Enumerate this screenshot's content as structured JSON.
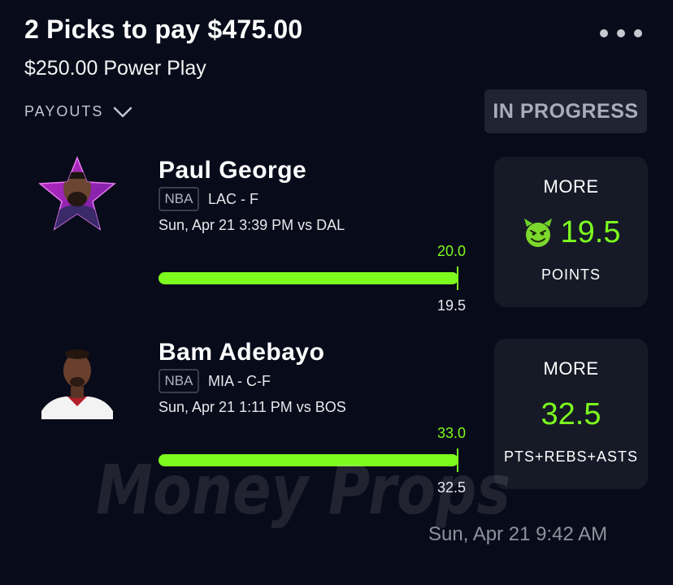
{
  "header": {
    "title": "2 Picks to pay $475.00",
    "subtitle": "$250.00 Power Play",
    "payouts_label": "PAYOUTS",
    "status": "IN PROGRESS"
  },
  "picks": [
    {
      "name": "Paul George",
      "league": "NBA",
      "team_pos": "LAC - F",
      "game_time": "Sun, Apr 21 3:39 PM  vs DAL",
      "actual": "20.0",
      "line": "19.5",
      "progress_fraction": 1.0,
      "direction": "MORE",
      "line_display": "19.5",
      "stat": "POINTS",
      "demon": true
    },
    {
      "name": "Bam Adebayo",
      "league": "NBA",
      "team_pos": "MIA - C-F",
      "game_time": "Sun, Apr 21 1:11 PM  vs BOS",
      "actual": "33.0",
      "line": "32.5",
      "progress_fraction": 1.0,
      "direction": "MORE",
      "line_display": "32.5",
      "stat": "PTS+REBS+ASTS",
      "demon": false
    }
  ],
  "watermark": "Money Props",
  "timestamp": "Sun, Apr 21 9:42 AM",
  "colors": {
    "background": "#080b1a",
    "accent_green": "#7dfa1e",
    "card": "#161a27",
    "badge": "#1f2432"
  },
  "icons": [
    "more-icon",
    "chevron-down-icon",
    "demon-icon",
    "star-avatar-frame"
  ]
}
